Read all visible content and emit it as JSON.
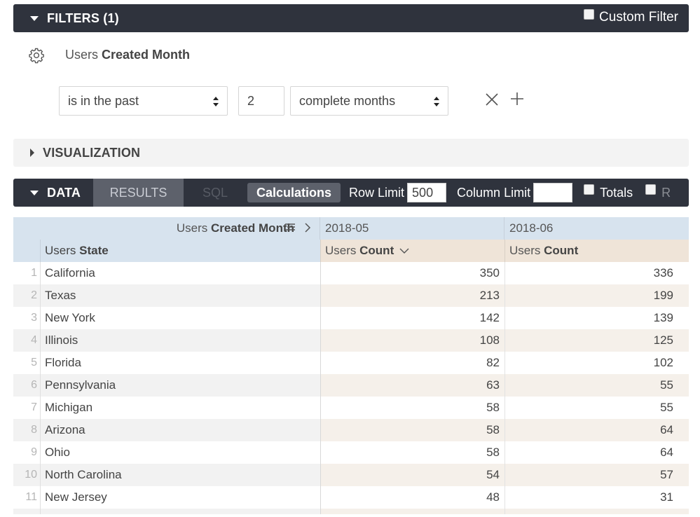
{
  "filters": {
    "title": "FILTERS (1)",
    "custom_filter_label": "Custom Filter",
    "field_view": "Users",
    "field_name": "Created Month",
    "operator": "is in the past",
    "value": "2",
    "unit": "complete months"
  },
  "visualization": {
    "title": "VISUALIZATION"
  },
  "data_bar": {
    "title": "DATA",
    "tabs": {
      "results": "RESULTS",
      "sql": "SQL"
    },
    "calculations_label": "Calculations",
    "row_limit_label": "Row Limit",
    "row_limit_value": "500",
    "column_limit_label": "Column Limit",
    "column_limit_value": "",
    "totals_label": "Totals",
    "truncated_label": "R"
  },
  "table": {
    "pivot_view": "Users",
    "pivot_field": "Created Month",
    "pivot_values": [
      "2018-05",
      "2018-06"
    ],
    "dimension_view": "Users",
    "dimension_field": "State",
    "measure_view": "Users",
    "measure_field": "Count",
    "rows": [
      {
        "idx": "1",
        "state": "California",
        "v1": "350",
        "v2": "336"
      },
      {
        "idx": "2",
        "state": "Texas",
        "v1": "213",
        "v2": "199"
      },
      {
        "idx": "3",
        "state": "New York",
        "v1": "142",
        "v2": "139"
      },
      {
        "idx": "4",
        "state": "Illinois",
        "v1": "108",
        "v2": "125"
      },
      {
        "idx": "5",
        "state": "Florida",
        "v1": "82",
        "v2": "102"
      },
      {
        "idx": "6",
        "state": "Pennsylvania",
        "v1": "63",
        "v2": "55"
      },
      {
        "idx": "7",
        "state": "Michigan",
        "v1": "58",
        "v2": "55"
      },
      {
        "idx": "8",
        "state": "Arizona",
        "v1": "58",
        "v2": "64"
      },
      {
        "idx": "9",
        "state": "Ohio",
        "v1": "58",
        "v2": "64"
      },
      {
        "idx": "10",
        "state": "North Carolina",
        "v1": "54",
        "v2": "57"
      },
      {
        "idx": "11",
        "state": "New Jersey",
        "v1": "48",
        "v2": "31"
      }
    ]
  },
  "icons": {
    "gear": "gear-icon",
    "remove": "close-icon",
    "add": "plus-icon",
    "sort": "chevron-down-icon",
    "pivot_menu": "lines-icon",
    "pivot_next": "chevron-right-icon"
  }
}
